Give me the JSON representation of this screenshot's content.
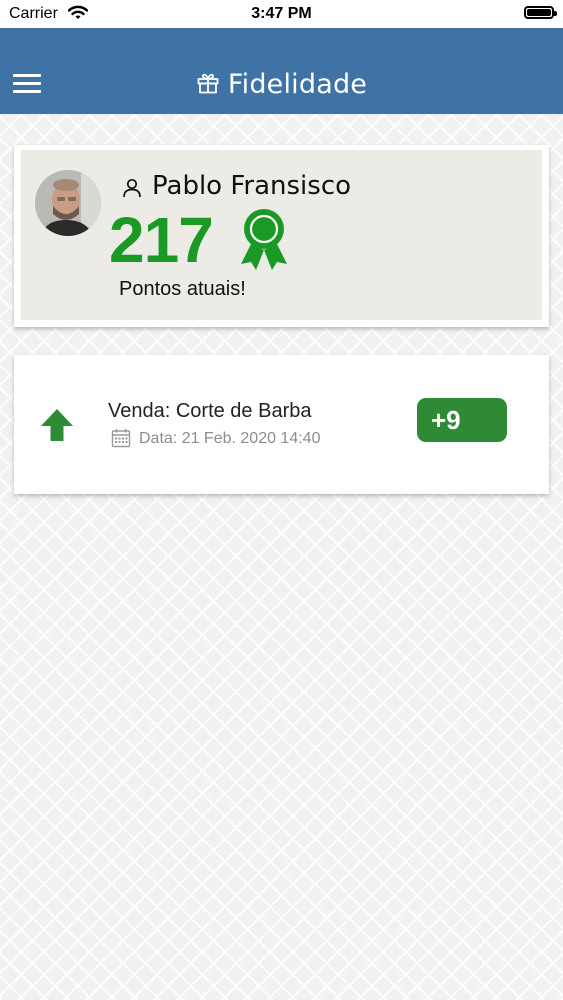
{
  "status_bar": {
    "carrier": "Carrier",
    "time": "3:47 PM",
    "icons": [
      "wifi-icon",
      "battery-icon"
    ]
  },
  "header": {
    "title": "Fidelidade",
    "icons": [
      "menu-icon",
      "gift-icon"
    ],
    "background_color": "#3f73a5"
  },
  "profile": {
    "name": "Pablo Fransisco",
    "points": "217",
    "points_label": "Pontos atuais!",
    "icons": [
      "avatar",
      "user-icon",
      "award-icon"
    ],
    "points_color": "#1a9a24"
  },
  "transactions": [
    {
      "title": "Venda: Corte de Barba",
      "date": "Data: 21 Feb. 2020 14:40",
      "points": "+9",
      "icons": [
        "arrow-up-icon",
        "calendar-icon"
      ],
      "badge_color": "#2e8a34"
    }
  ]
}
